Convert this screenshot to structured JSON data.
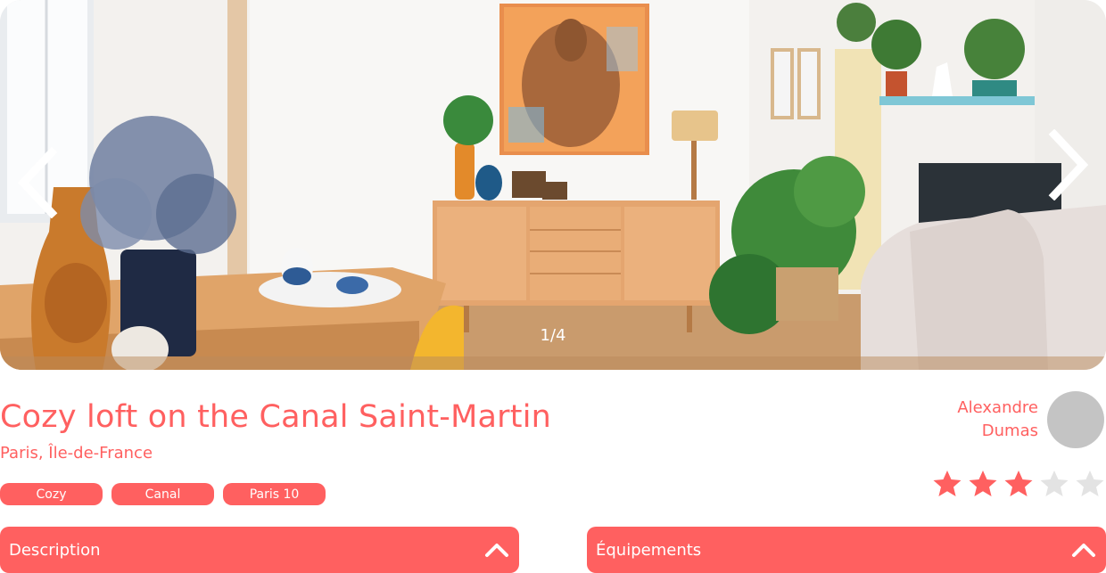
{
  "gallery": {
    "counter": "1/4",
    "prev_icon": "chevron-left-icon",
    "next_icon": "chevron-right-icon"
  },
  "listing": {
    "title": "Cozy loft on the Canal Saint-Martin",
    "location": "Paris, Île-de-France",
    "tags": [
      "Cozy",
      "Canal",
      "Paris 10"
    ]
  },
  "host": {
    "first_name": "Alexandre",
    "last_name": "Dumas"
  },
  "rating": {
    "value": 3,
    "max": 5
  },
  "collapses": {
    "description": {
      "label": "Description",
      "icon": "chevron-up-icon"
    },
    "equipments": {
      "label": "Équipements",
      "icon": "chevron-up-icon"
    }
  },
  "colors": {
    "accent": "#FF6060",
    "star_empty": "#E3E3E3",
    "avatar": "#C4C4C4"
  }
}
